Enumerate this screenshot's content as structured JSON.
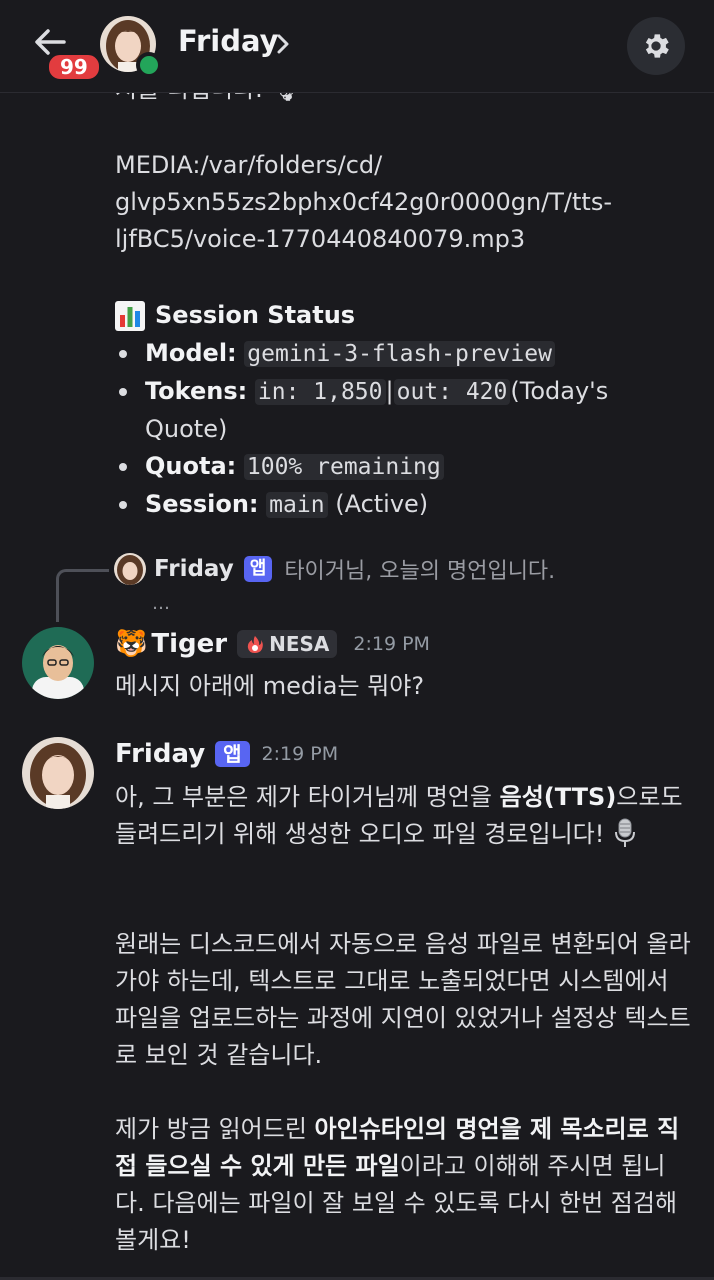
{
  "header": {
    "title": "Friday",
    "unread_count": "99",
    "icons": {
      "back": "arrow-left-icon",
      "chevron": "chevron-right-icon",
      "settings": "gear-icon"
    }
  },
  "previous_message": {
    "cutoff_text": "지를 디립니다. 🎙",
    "media_line1": "MEDIA:/var/folders/cd/",
    "media_line2": "glvp5xn55zs2bphx0cf42g0r0000gn/T/tts-",
    "media_line3": "ljfBC5/voice-1770440840079.mp3",
    "status_title": "Session Status",
    "status": [
      {
        "key": "Model:",
        "code": "gemini-3-flash-preview"
      },
      {
        "key": "Tokens:",
        "code": "in: 1,850",
        "sep": "|",
        "code2": "out: 420",
        "rest": "(Today's Quote)"
      },
      {
        "key": "Quota:",
        "code": "100% remaining"
      },
      {
        "key": "Session:",
        "code": "main",
        "rest": "(Active)"
      }
    ]
  },
  "reply": {
    "author": "Friday",
    "tag": "앱",
    "preview": "타이거님, 오늘의 명언입니다.",
    "ellipsis": "…"
  },
  "message_tiger": {
    "author_emoji": "🐯",
    "author": "Tiger",
    "role": "NESA",
    "time": "2:19 PM",
    "text": "메시지 아래에 media는 뭐야?"
  },
  "message_friday": {
    "author": "Friday",
    "tag": "앱",
    "time": "2:19 PM",
    "p1_a": "아, 그 부분은 제가 타이거님께 명언을 ",
    "p1_b": "음성(TTS)",
    "p1_c": "으로도 들려드리기 위해 생성한 오디오 파일 경로입니다!",
    "p2": "원래는 디스코드에서 자동으로 음성 파일로 변환되어 올라가야 하는데, 텍스트로 그대로 노출되었다면 시스템에서 파일을 업로드하는 과정에 지연이 있었거나 설정상 텍스트로 보인 것 같습니다.",
    "p3_a": "제가 방금 읽어드린 ",
    "p3_b": "아인슈타인의 명언을 제 목소리로 직접 들으실 수 있게 만든 파일",
    "p3_c": "이라고 이해해 주시면 됩니다. 다음에는 파일이 잘 보일 수 있도록 다시 한번 점검해 볼게요!"
  },
  "colors": {
    "background": "#1a1a1e",
    "app_tag": "#5865f2",
    "badge": "#e23c3f",
    "online": "#23a55a"
  }
}
